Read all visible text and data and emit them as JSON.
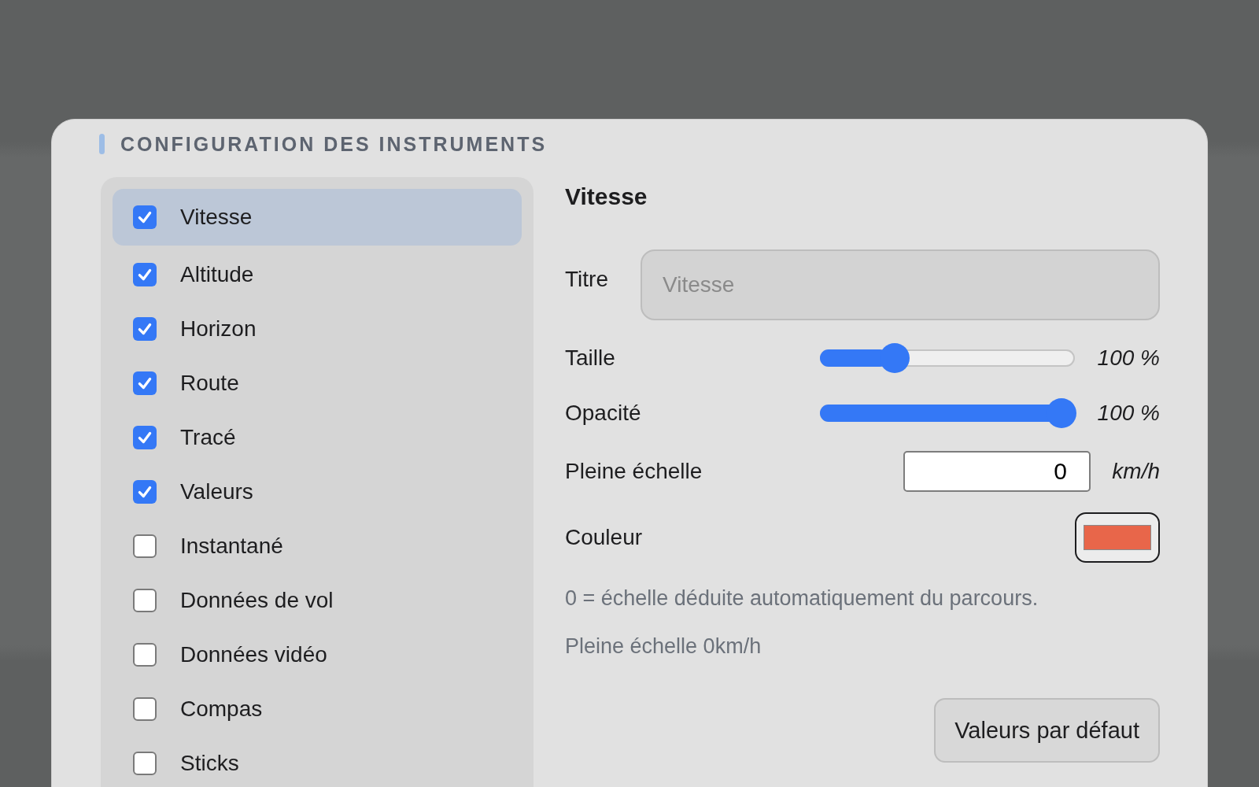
{
  "dialog": {
    "title": "CONFIGURATION DES INSTRUMENTS"
  },
  "instruments": [
    {
      "label": "Vitesse",
      "checked": true,
      "selected": true
    },
    {
      "label": "Altitude",
      "checked": true,
      "selected": false
    },
    {
      "label": "Horizon",
      "checked": true,
      "selected": false
    },
    {
      "label": "Route",
      "checked": true,
      "selected": false
    },
    {
      "label": "Tracé",
      "checked": true,
      "selected": false
    },
    {
      "label": "Valeurs",
      "checked": true,
      "selected": false
    },
    {
      "label": "Instantané",
      "checked": false,
      "selected": false
    },
    {
      "label": "Données de vol",
      "checked": false,
      "selected": false
    },
    {
      "label": "Données vidéo",
      "checked": false,
      "selected": false
    },
    {
      "label": "Compas",
      "checked": false,
      "selected": false
    },
    {
      "label": "Sticks",
      "checked": false,
      "selected": false
    }
  ],
  "detail": {
    "heading": "Vitesse",
    "title_field": {
      "label": "Titre",
      "placeholder": "Vitesse"
    },
    "sliders": [
      {
        "label": "Taille",
        "level": 0.27,
        "reading": "100 %"
      },
      {
        "label": "Opacité",
        "level": 1,
        "reading": "100 %"
      }
    ],
    "full_scale": {
      "label": "Pleine échelle",
      "value": "0",
      "unit": "km/h"
    },
    "color_field": {
      "label": "Couleur",
      "color": "#e8664a"
    },
    "hint": "0 = échelle déduite automatiquement du parcours.",
    "summary": "Pleine échelle 0km/h",
    "reset_button": "Valeurs par défaut"
  }
}
